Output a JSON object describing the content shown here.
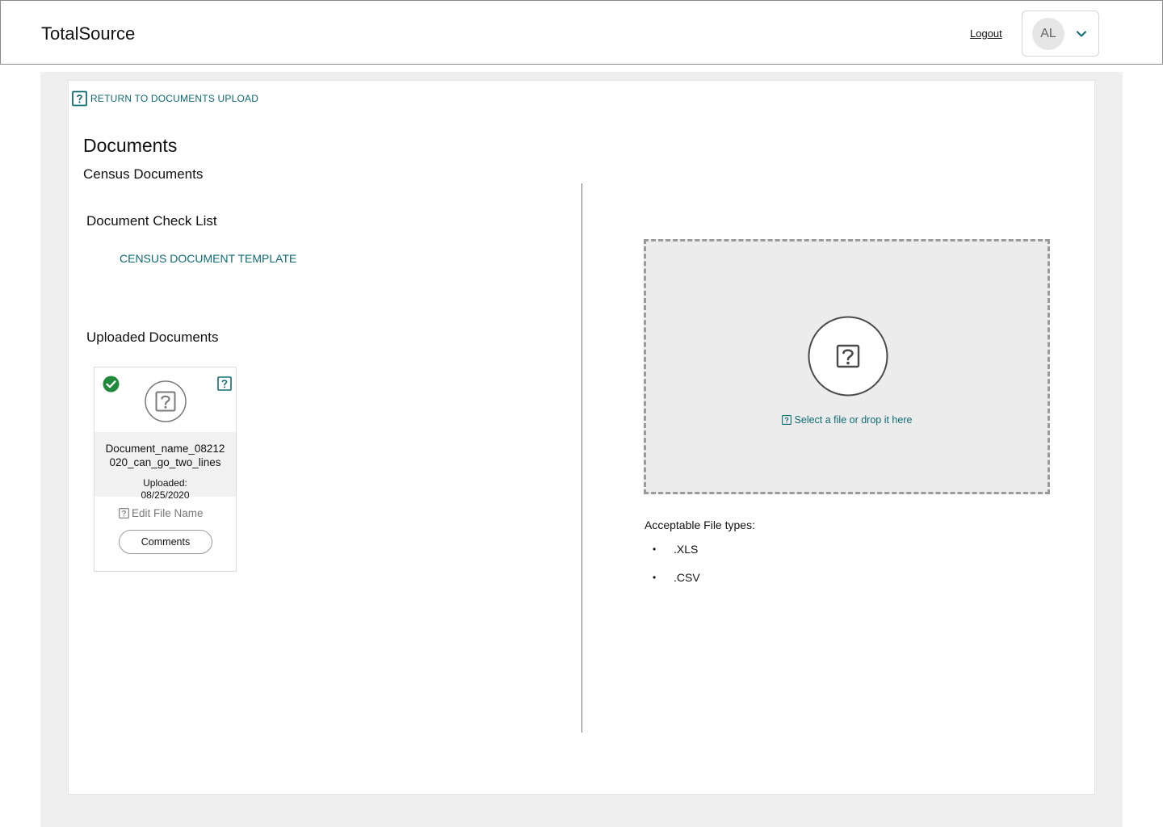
{
  "header": {
    "brand": "TotalSource",
    "logout_label": "Logout",
    "user_initials": "AL"
  },
  "nav": {
    "return_label": "RETURN TO DOCUMENTS UPLOAD"
  },
  "page": {
    "title": "Documents",
    "subtitle": "Census Documents"
  },
  "checklist": {
    "title": "Document Check List",
    "items": [
      "CENSUS DOCUMENT TEMPLATE"
    ]
  },
  "uploaded": {
    "title": "Uploaded Documents",
    "documents": [
      {
        "name_line1": "Document_name_08212",
        "name_line2": "020_can_go_two_lines",
        "uploaded_label": "Uploaded:",
        "uploaded_date": "08/25/2020",
        "edit_label": "Edit File Name",
        "comments_label": "Comments",
        "status": "verified"
      }
    ]
  },
  "upload": {
    "dropzone_label": "Select a file or drop it here",
    "types_title": "Acceptable File types:",
    "types": [
      ".XLS",
      ".CSV"
    ]
  },
  "colors": {
    "link": "#0e6b72",
    "success": "#1f8a3b",
    "page_bg": "#efefef",
    "dropzone_bg": "#ececec"
  },
  "icons": {
    "return": "help-square-icon",
    "check": "check-circle-icon",
    "corner": "help-square-icon",
    "thumbnail": "help-circle-icon",
    "edit": "help-square-icon",
    "dropzone": "help-circle-icon",
    "user_menu": "chevron-down-icon"
  }
}
